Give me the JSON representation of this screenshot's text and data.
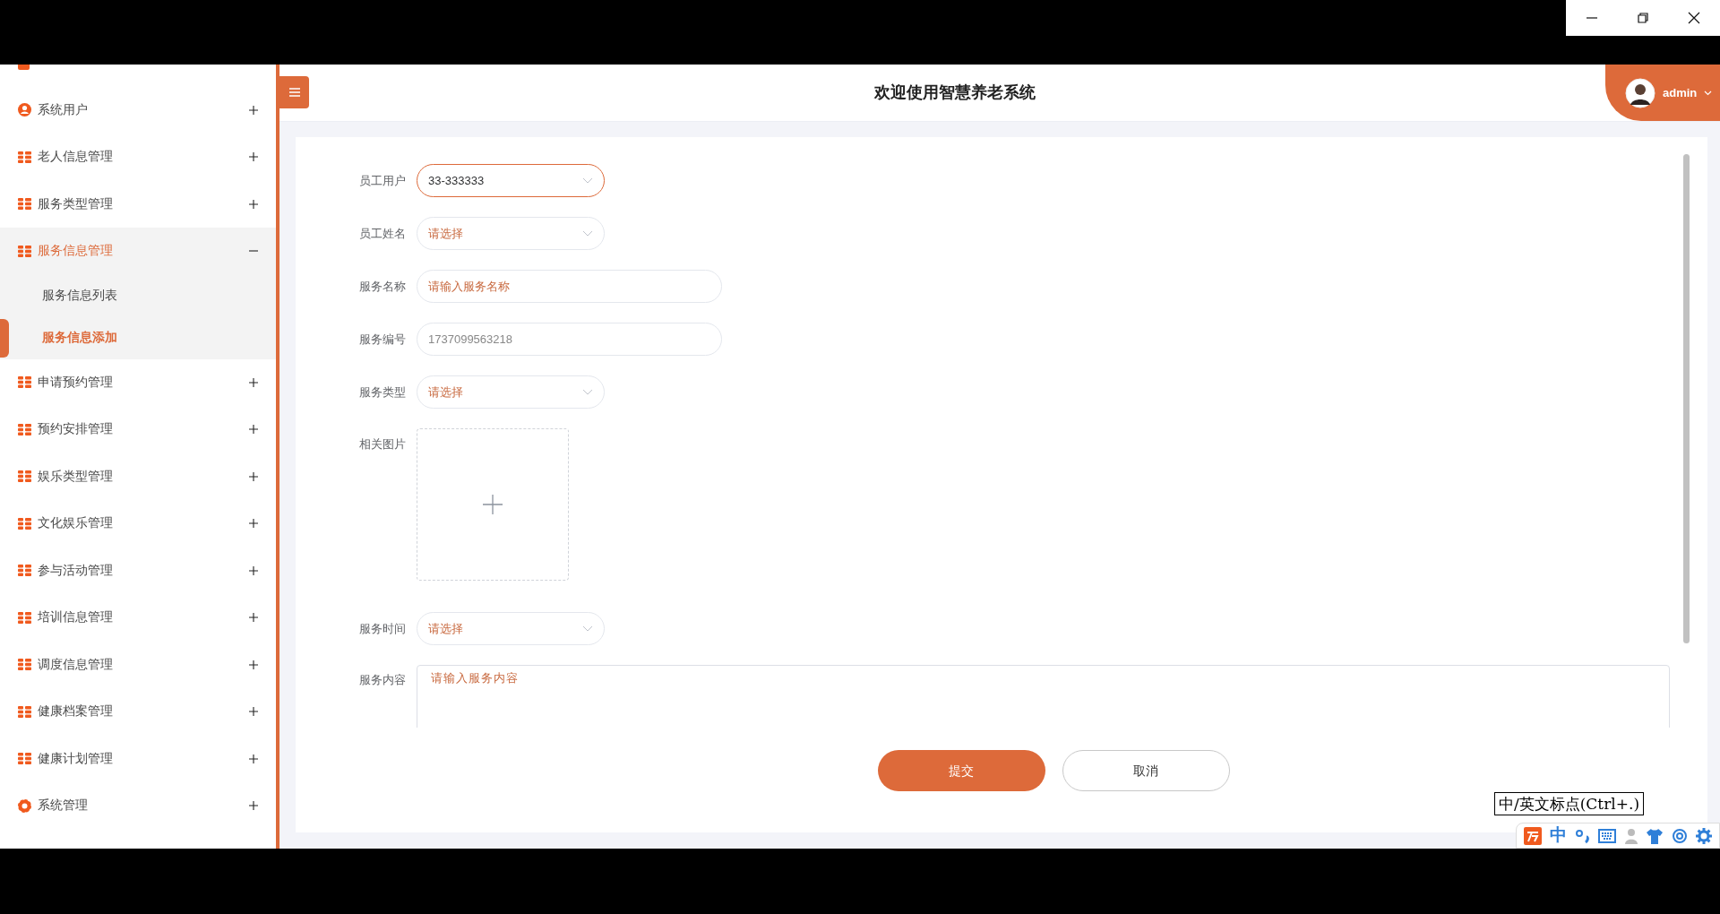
{
  "header": {
    "title": "欢迎使用智慧养老系统",
    "user": "admin"
  },
  "sidebar": {
    "items": [
      {
        "kind": "doc"
      },
      {
        "label": "系统用户",
        "kind": "user",
        "expanded": false
      },
      {
        "label": "老人信息管理",
        "kind": "grid",
        "expanded": false
      },
      {
        "label": "服务类型管理",
        "kind": "grid",
        "expanded": false
      },
      {
        "label": "服务信息管理",
        "kind": "grid",
        "expanded": true,
        "children": [
          {
            "label": "服务信息列表",
            "selected": false
          },
          {
            "label": "服务信息添加",
            "selected": true
          }
        ]
      },
      {
        "label": "申请预约管理",
        "kind": "grid",
        "expanded": false
      },
      {
        "label": "预约安排管理",
        "kind": "grid",
        "expanded": false
      },
      {
        "label": "娱乐类型管理",
        "kind": "grid",
        "expanded": false
      },
      {
        "label": "文化娱乐管理",
        "kind": "grid",
        "expanded": false
      },
      {
        "label": "参与活动管理",
        "kind": "grid",
        "expanded": false
      },
      {
        "label": "培训信息管理",
        "kind": "grid",
        "expanded": false
      },
      {
        "label": "调度信息管理",
        "kind": "grid",
        "expanded": false
      },
      {
        "label": "健康档案管理",
        "kind": "grid",
        "expanded": false
      },
      {
        "label": "健康计划管理",
        "kind": "grid",
        "expanded": false
      },
      {
        "label": "系统管理",
        "kind": "gear",
        "expanded": false
      }
    ]
  },
  "form": {
    "fields": [
      {
        "label": "员工用户",
        "kind": "select",
        "value": "33-333333",
        "focused": true
      },
      {
        "label": "员工姓名",
        "kind": "select",
        "placeholder": "请选择",
        "focused": false
      },
      {
        "label": "服务名称",
        "kind": "input",
        "placeholder": "请输入服务名称",
        "focused": false
      },
      {
        "label": "服务编号",
        "kind": "input",
        "value": "1737099563218",
        "focused": false
      },
      {
        "label": "服务类型",
        "kind": "select",
        "placeholder": "请选择",
        "focused": false
      },
      {
        "label": "相关图片",
        "kind": "upload"
      },
      {
        "label": "服务时间",
        "kind": "select",
        "placeholder": "请选择",
        "focused": false
      },
      {
        "label": "服务内容",
        "kind": "textarea",
        "placeholder": "请输入服务内容"
      }
    ],
    "buttons": [
      {
        "label": "提交",
        "kind": "primary"
      },
      {
        "label": "取消",
        "kind": "secondary"
      }
    ]
  },
  "ime": {
    "tooltip": "中/英文标点(Ctrl+.)",
    "mode": "中"
  }
}
